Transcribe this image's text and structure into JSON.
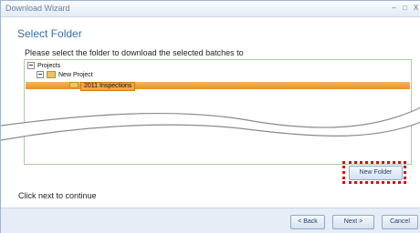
{
  "window": {
    "title": "Download Wizard",
    "minimize_glyph": "–",
    "maximize_glyph": "□",
    "close_glyph": "X"
  },
  "page": {
    "heading": "Select Folder",
    "instruction": "Please select the folder to download the selected batches to",
    "footer_hint": "Click next to continue"
  },
  "tree": {
    "root_label": "Projects",
    "project_label": "New Project",
    "selected_label": "2011 Inspections"
  },
  "buttons": {
    "new_folder": "New Folder",
    "back": "< Back",
    "next": "Next >",
    "cancel": "Cancel"
  },
  "colors": {
    "selection": "#ee8f22",
    "highlight": "#d60f0f",
    "heading": "#3a6ea5"
  }
}
